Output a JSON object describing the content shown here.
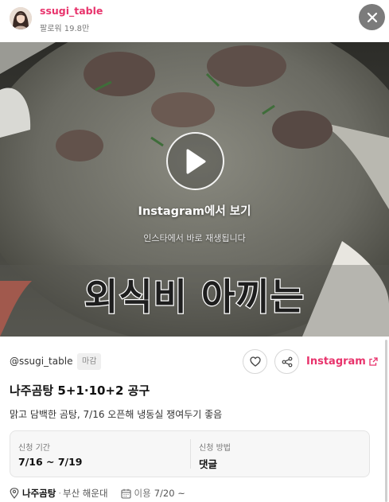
{
  "profile": {
    "name": "ssugi_table",
    "followers": "팔로워 19.8만"
  },
  "media": {
    "view_label": "Instagram에서 보기",
    "sub_label": "인스타에서 바로 재생됩니다",
    "caption": "외식비 아끼는"
  },
  "post": {
    "handle": "@ssugi_table",
    "status_badge": "마감",
    "instagram_link": "Instagram",
    "title": "나주곰탕 5+1·10+2 공구",
    "description": "맑고 담백한 곰탕, 7/16 오픈해 냉동실 쟁여두기 좋음",
    "period_label": "신청 기간",
    "period_value": "7/16 ~ 7/19",
    "method_label": "신청 방법",
    "method_value": "댓글",
    "place_name": "나주곰탕",
    "place_separator": "·",
    "place_area": "부산 해운대",
    "use_label": "이용",
    "use_value": "7/20 ~"
  },
  "icons": {
    "close": "close-icon",
    "play": "play-icon",
    "like": "heart-icon",
    "share": "share-icon",
    "external": "external-link-icon",
    "location": "map-pin-icon",
    "calendar": "calendar-icon"
  },
  "colors": {
    "brand": "#e8336c",
    "close_button": "#7b7b7b"
  }
}
